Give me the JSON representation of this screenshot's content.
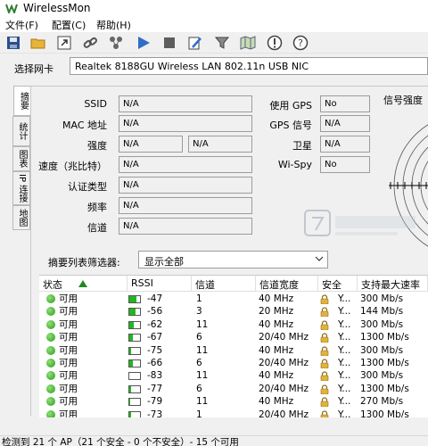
{
  "window": {
    "title": "WirelessMon"
  },
  "menu": [
    "文件(F)",
    "配置(C)",
    "帮助(H)"
  ],
  "toolbar": {
    "icons": [
      "save-icon",
      "open-folder-icon",
      "export-icon",
      "link-icon",
      "network-icon",
      "play-icon",
      "stop-icon",
      "edit-icon",
      "filter-icon",
      "map-icon",
      "alert-icon",
      "help-icon"
    ]
  },
  "adapter": {
    "label": "选择网卡",
    "value": "Realtek 8188GU Wireless LAN 802.11n USB NIC"
  },
  "tabs": [
    "摘要",
    "统计",
    "图表",
    "IP 连接",
    "地图"
  ],
  "summary": {
    "ssid_label": "SSID",
    "ssid": "N/A",
    "mac_label": "MAC 地址",
    "mac": "N/A",
    "strength_label": "强度",
    "strength_1": "N/A",
    "strength_2": "N/A",
    "speed_label": "速度（兆比特）",
    "speed": "N/A",
    "auth_label": "认证类型",
    "auth": "N/A",
    "freq_label": "频率",
    "freq": "N/A",
    "channel_label": "信道",
    "channel": "N/A",
    "gps_label": "使用 GPS",
    "gps": "No",
    "gps_signal_label": "GPS 信号",
    "gps_signal": "N/A",
    "sat_label": "卫星",
    "sat": "N/A",
    "wispy_label": "Wi-Spy",
    "wispy": "No"
  },
  "signal_panel": {
    "title": "信号强度"
  },
  "filter": {
    "label": "摘要列表筛选器:",
    "value": "显示全部"
  },
  "table": {
    "columns": [
      "状态",
      "RSSI",
      "信道",
      "信道宽度",
      "安全",
      "支持最大速率"
    ],
    "rows": [
      {
        "status": "可用",
        "rssi": "-47",
        "signal": 0.7,
        "channel": "1",
        "width": "40 MHz",
        "security": "Y...",
        "rate": "300 Mb/s"
      },
      {
        "status": "可用",
        "rssi": "-56",
        "signal": 0.55,
        "channel": "3",
        "width": "20 MHz",
        "security": "Y...",
        "rate": "144 Mb/s"
      },
      {
        "status": "可用",
        "rssi": "-62",
        "signal": 0.45,
        "channel": "11",
        "width": "40 MHz",
        "security": "Y...",
        "rate": "300 Mb/s"
      },
      {
        "status": "可用",
        "rssi": "-67",
        "signal": 0.35,
        "channel": "6",
        "width": "20/40 MHz",
        "security": "Y...",
        "rate": "1300 Mb/s"
      },
      {
        "status": "可用",
        "rssi": "-75",
        "signal": 0.2,
        "channel": "11",
        "width": "40 MHz",
        "security": "Y...",
        "rate": "300 Mb/s"
      },
      {
        "status": "可用",
        "rssi": "-66",
        "signal": 0.35,
        "channel": "6",
        "width": "20/40 MHz",
        "security": "Y...",
        "rate": "1300 Mb/s"
      },
      {
        "status": "可用",
        "rssi": "-83",
        "signal": 0.0,
        "channel": "11",
        "width": "40 MHz",
        "security": "Y...",
        "rate": "300 Mb/s"
      },
      {
        "status": "可用",
        "rssi": "-77",
        "signal": 0.15,
        "channel": "6",
        "width": "20/40 MHz",
        "security": "Y...",
        "rate": "1300 Mb/s"
      },
      {
        "status": "可用",
        "rssi": "-79",
        "signal": 0.12,
        "channel": "11",
        "width": "40 MHz",
        "security": "Y...",
        "rate": "270 Mb/s"
      },
      {
        "status": "可用",
        "rssi": "-73",
        "signal": 0.2,
        "channel": "1",
        "width": "20/40 MHz",
        "security": "Y...",
        "rate": "1300 Mb/s"
      }
    ]
  },
  "status": {
    "text": "检测到 21 个 AP（21 个安全 - 0 个不安全）- 15 个可用"
  },
  "colors": {
    "signal_green": "#1fb81f",
    "status_green": "#2b9a1a"
  }
}
